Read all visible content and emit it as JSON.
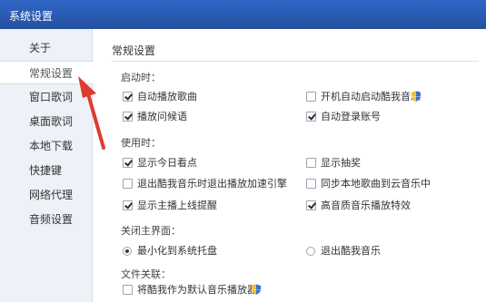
{
  "window": {
    "title": "系统设置"
  },
  "sidebar": {
    "items": [
      {
        "label": "关于"
      },
      {
        "label": "常规设置",
        "active": true
      },
      {
        "label": "窗口歌词"
      },
      {
        "label": "桌面歌词"
      },
      {
        "label": "本地下载"
      },
      {
        "label": "快捷键"
      },
      {
        "label": "网络代理"
      },
      {
        "label": "音频设置"
      }
    ]
  },
  "main": {
    "section_title": "常规设置",
    "startup": {
      "label": "启动时：",
      "options": [
        {
          "label": "自动播放歌曲",
          "checked": true
        },
        {
          "label": "开机自动启动酷我音乐",
          "checked": false
        },
        {
          "label": "播放问候语",
          "checked": true
        },
        {
          "label": "自动登录账号",
          "checked": true
        }
      ]
    },
    "usage": {
      "label": "使用时：",
      "options": [
        {
          "label": "显示今日看点",
          "checked": true
        },
        {
          "label": "显示抽奖",
          "checked": false
        },
        {
          "label": "退出酷我音乐时退出播放加速引擎",
          "checked": false
        },
        {
          "label": "同步本地歌曲到云音乐中",
          "checked": false
        },
        {
          "label": "显示主播上线提醒",
          "checked": true
        },
        {
          "label": "高音质音乐播放特效",
          "checked": true
        }
      ]
    },
    "close": {
      "label": "关闭主界面：",
      "options": [
        {
          "label": "最小化到系统托盘",
          "selected": true
        },
        {
          "label": "退出酷我音乐",
          "selected": false
        }
      ]
    },
    "file_assoc": {
      "label": "文件关联：",
      "options": [
        {
          "label": "将酷我作为默认音乐播放器",
          "checked": false
        }
      ]
    }
  },
  "colors": {
    "titlebar": "#2a5bb3",
    "sidebar_bg": "#eef2f8",
    "annotation_arrow": "#e03b2e"
  },
  "icons": {
    "uac_shield": "shield-icon"
  }
}
